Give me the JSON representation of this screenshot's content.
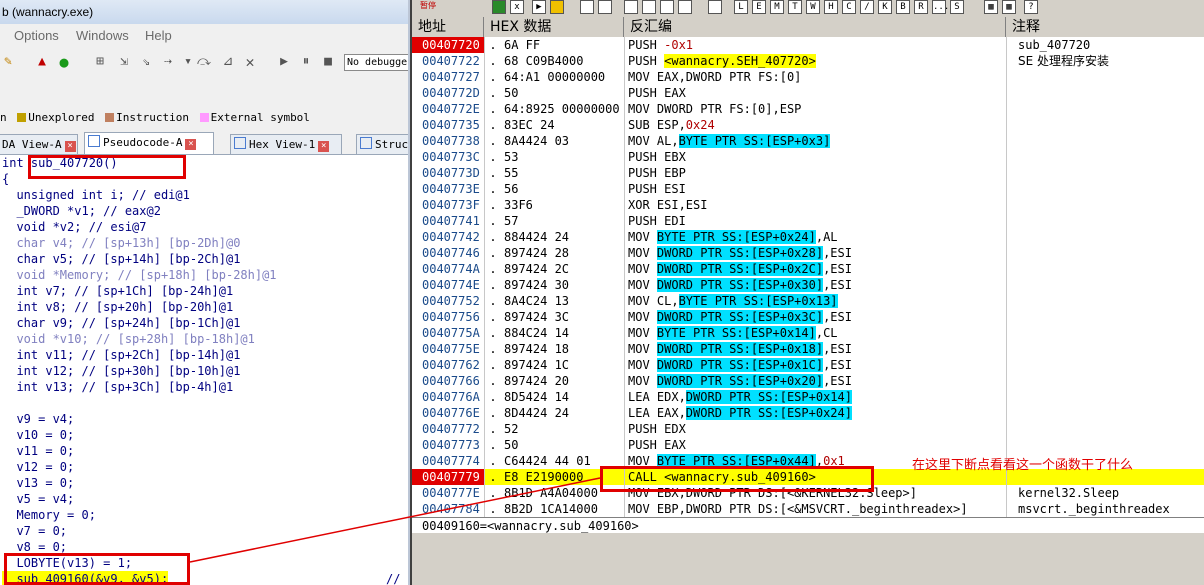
{
  "ida": {
    "window_title": "b (wannacry.exe)",
    "menu": [
      "Options",
      "Windows",
      "Help"
    ],
    "debugger_select": "No debugge",
    "legend": [
      {
        "label": "n",
        "color": ""
      },
      {
        "label": "Unexplored",
        "color": "#c0a000"
      },
      {
        "label": "Instruction",
        "color": "#c08060"
      },
      {
        "label": "External symbol",
        "color": "#ff99ff"
      }
    ],
    "tabs": [
      {
        "label": "DA View-A"
      },
      {
        "label": "Pseudocode-A"
      },
      {
        "label": "Hex View-1"
      },
      {
        "label": "Struc"
      }
    ],
    "code_lines": [
      "int sub_407720()",
      "{",
      "  unsigned int i; // edi@1",
      "  _DWORD *v1; // eax@2",
      "  void *v2; // esi@7",
      "  char v4; // [sp+13h] [bp-2Dh]@0",
      "  char v5; // [sp+14h] [bp-2Ch]@1",
      "  void *Memory; // [sp+18h] [bp-28h]@1",
      "  int v7; // [sp+1Ch] [bp-24h]@1",
      "  int v8; // [sp+20h] [bp-20h]@1",
      "  char v9; // [sp+24h] [bp-1Ch]@1",
      "  void *v10; // [sp+28h] [bp-18h]@1",
      "  int v11; // [sp+2Ch] [bp-14h]@1",
      "  int v12; // [sp+30h] [bp-10h]@1",
      "  int v13; // [sp+3Ch] [bp-4h]@1",
      "",
      "  v9 = v4;",
      "  v10 = 0;",
      "  v11 = 0;",
      "  v12 = 0;",
      "  v13 = 0;",
      "  v5 = v4;",
      "  Memory = 0;",
      "  v7 = 0;",
      "  v8 = 0;",
      "  LOBYTE(v13) = 1;",
      "  sub_409160(&v9, &v5);"
    ],
    "trailing_comment": "//"
  },
  "olly": {
    "toolbar_label": "暂停",
    "toolbar_letters": [
      "L",
      "E",
      "M",
      "T",
      "W",
      "H",
      "C",
      "/",
      "K",
      "B",
      "R",
      "...",
      "S"
    ],
    "columns": [
      "地址",
      "HEX 数据",
      "反汇编",
      "注释"
    ],
    "rows": [
      {
        "addr": "00407720",
        "hex": "6A FF",
        "asm": "PUSH -0x1",
        "cmt": "sub_407720"
      },
      {
        "addr": "00407722",
        "hex": "68 C09B4000",
        "asm": "PUSH <wannacry.SEH_407720>",
        "cmt": "SE 处理程序安装"
      },
      {
        "addr": "00407727",
        "hex": "64:A1 00000000",
        "asm": "MOV EAX,DWORD PTR FS:[0]",
        "cmt": ""
      },
      {
        "addr": "0040772D",
        "hex": "50",
        "asm": "PUSH EAX",
        "cmt": ""
      },
      {
        "addr": "0040772E",
        "hex": "64:8925 00000000",
        "asm": "MOV DWORD PTR FS:[0],ESP",
        "cmt": ""
      },
      {
        "addr": "00407735",
        "hex": "83EC 24",
        "asm": "SUB ESP,0x24",
        "cmt": ""
      },
      {
        "addr": "00407738",
        "hex": "8A4424 03",
        "asm": "MOV AL,BYTE PTR SS:[ESP+0x3]",
        "cmt": ""
      },
      {
        "addr": "0040773C",
        "hex": "53",
        "asm": "PUSH EBX",
        "cmt": ""
      },
      {
        "addr": "0040773D",
        "hex": "55",
        "asm": "PUSH EBP",
        "cmt": ""
      },
      {
        "addr": "0040773E",
        "hex": "56",
        "asm": "PUSH ESI",
        "cmt": ""
      },
      {
        "addr": "0040773F",
        "hex": "33F6",
        "asm": "XOR ESI,ESI",
        "cmt": ""
      },
      {
        "addr": "00407741",
        "hex": "57",
        "asm": "PUSH EDI",
        "cmt": ""
      },
      {
        "addr": "00407742",
        "hex": "884424 24",
        "asm": "MOV BYTE PTR SS:[ESP+0x24],AL",
        "cmt": ""
      },
      {
        "addr": "00407746",
        "hex": "897424 28",
        "asm": "MOV DWORD PTR SS:[ESP+0x28],ESI",
        "cmt": ""
      },
      {
        "addr": "0040774A",
        "hex": "897424 2C",
        "asm": "MOV DWORD PTR SS:[ESP+0x2C],ESI",
        "cmt": ""
      },
      {
        "addr": "0040774E",
        "hex": "897424 30",
        "asm": "MOV DWORD PTR SS:[ESP+0x30],ESI",
        "cmt": ""
      },
      {
        "addr": "00407752",
        "hex": "8A4C24 13",
        "asm": "MOV CL,BYTE PTR SS:[ESP+0x13]",
        "cmt": ""
      },
      {
        "addr": "00407756",
        "hex": "897424 3C",
        "asm": "MOV DWORD PTR SS:[ESP+0x3C],ESI",
        "cmt": ""
      },
      {
        "addr": "0040775A",
        "hex": "884C24 14",
        "asm": "MOV BYTE PTR SS:[ESP+0x14],CL",
        "cmt": ""
      },
      {
        "addr": "0040775E",
        "hex": "897424 18",
        "asm": "MOV DWORD PTR SS:[ESP+0x18],ESI",
        "cmt": ""
      },
      {
        "addr": "00407762",
        "hex": "897424 1C",
        "asm": "MOV DWORD PTR SS:[ESP+0x1C],ESI",
        "cmt": ""
      },
      {
        "addr": "00407766",
        "hex": "897424 20",
        "asm": "MOV DWORD PTR SS:[ESP+0x20],ESI",
        "cmt": ""
      },
      {
        "addr": "0040776A",
        "hex": "8D5424 14",
        "asm": "LEA EDX,DWORD PTR SS:[ESP+0x14]",
        "cmt": ""
      },
      {
        "addr": "0040776E",
        "hex": "8D4424 24",
        "asm": "LEA EAX,DWORD PTR SS:[ESP+0x24]",
        "cmt": ""
      },
      {
        "addr": "00407772",
        "hex": "52",
        "asm": "PUSH EDX",
        "cmt": ""
      },
      {
        "addr": "00407773",
        "hex": "50",
        "asm": "PUSH EAX",
        "cmt": ""
      },
      {
        "addr": "00407774",
        "hex": "C64424 44 01",
        "asm": "MOV BYTE PTR SS:[ESP+0x44],0x1",
        "cmt": ""
      },
      {
        "addr": "00407779",
        "hex": "E8 E2190000",
        "asm": "CALL <wannacry.sub_409160>",
        "cmt": ""
      },
      {
        "addr": "0040777E",
        "hex": "8B1D A4A04000",
        "asm": "MOV EBX,DWORD PTR DS:[<&KERNEL32.Sleep>]",
        "cmt": "kernel32.Sleep"
      },
      {
        "addr": "00407784",
        "hex": "8B2D 1CA14000",
        "asm": "MOV EBP,DWORD PTR DS:[<&MSVCRT._beginthreadex>]",
        "cmt": "msvcrt._beginthreadex"
      }
    ],
    "info_line": "00409160=<wannacry.sub_409160>"
  },
  "annotation_text": "在这里下断点看看这一个函数干了什么",
  "colors": {
    "accent_red": "#e00000",
    "highlight_yellow": "#ffff00",
    "mem_cyan": "#00e0ff"
  }
}
